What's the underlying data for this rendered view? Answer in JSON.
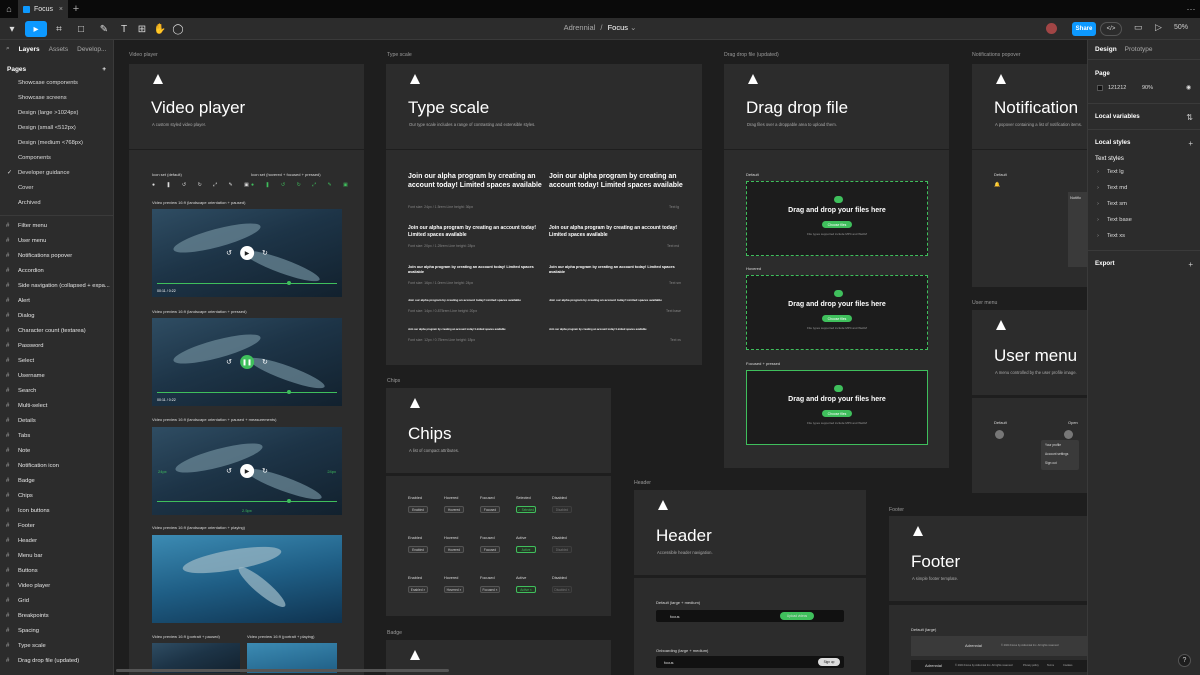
{
  "tabbar": {
    "home_icon": "⌂",
    "tab_label": "Focus",
    "close": "×",
    "add": "+",
    "more": "⋯"
  },
  "toolbar": {
    "tools": [
      "▾",
      "▸",
      "⌗",
      "□",
      "✎",
      "T",
      "⊞",
      "✋",
      "◯"
    ],
    "project": "Adrennial",
    "sep": "/",
    "file": "Focus",
    "file_arrow": "⌄",
    "share": "Share",
    "code": "</>",
    "book_icon": "▭",
    "play_icon": "▷",
    "zoom": "50%"
  },
  "left": {
    "tabs": [
      "Layers",
      "Assets",
      "Develop..."
    ],
    "pages_title": "Pages",
    "pages_add": "+",
    "pages": [
      "Showcase components",
      "Showcase screens",
      "Design (large >1024px)",
      "Design (small <512px)",
      "Design (medium <768px)",
      "Components",
      "Developer guidance",
      "Cover",
      "Archived"
    ],
    "check": "✓",
    "layers": [
      "Filter menu",
      "User menu",
      "Notifications popover",
      "Accordion",
      "Side navigation (collapsed + expa...",
      "Alert",
      "Dialog",
      "Character count (textarea)",
      "Password",
      "Select",
      "Username",
      "Search",
      "Multi-select",
      "Details",
      "Tabs",
      "Note",
      "Notification icon",
      "Badge",
      "Chips",
      "Icon buttons",
      "Footer",
      "Header",
      "Menu bar",
      "Buttons",
      "Video player",
      "Grid",
      "Breakpoints",
      "Spacing",
      "Type scale",
      "Drag drop file (updated)"
    ]
  },
  "frames": {
    "video": {
      "label": "Video player",
      "title": "Video player",
      "desc": "A custom styled video player.",
      "iconset_default": "Icon set (default)",
      "iconset_hover": "Icon set (hovered + focused + pressed)",
      "v1": "Video preview 16:9 (landscape orientation + paused)",
      "v2": "Video preview 16:9 (landscape orientation + pressed)",
      "v3": "Video preview 16:9 (landscape orientation + paused + measurements)",
      "v4": "Video preview 16:9 (landscape orientation + playing)",
      "v5": "Video preview 16:9 (portrait + paused)",
      "v6": "Video preview 16:9 (portrait + playing)",
      "time": "00:11 / 0:22",
      "play": "▶",
      "pause": "❚❚",
      "skip_back": "↺",
      "skip_fwd": "↻",
      "measure_l": "24px",
      "measure_r": "24px",
      "measure_b": "2.5px",
      "progress": 0.7
    },
    "type": {
      "label": "Type scale",
      "title": "Type scale",
      "desc": "Our type scale includes a range of contrasting and extensible styles.",
      "sample": "Join our alpha program by creating an account today! Limited spaces available",
      "m1": "Font size: 24px / 1.5rem    Line height: 36px",
      "m2": "Font size: 20px / 1.25rem    Line height: 28px",
      "m3": "Font size: 16px / 1.0rem    Line height: 24px",
      "m4": "Font size: 14px / 0.875rem    Line height: 20px",
      "m5": "Font size: 12px / 0.75rem    Line height: 18px",
      "n1": "Text lg",
      "n2": "Text md",
      "n3": "Text sm",
      "n4": "Text base",
      "n5": "Text xs"
    },
    "drag": {
      "label": "Drag drop file (updated)",
      "title": "Drag drop file",
      "desc": "Drag files over a droppable area to upload them.",
      "s1": "Default",
      "s2": "Hovered",
      "s3": "Focused + pressed",
      "text": "Drag and drop your files here",
      "button": "Choose files",
      "sub": "File types supported include MP4 and WebM"
    },
    "notif": {
      "label": "Notifications popover",
      "title": "Notification",
      "desc": "A popover containing a list of notification items.",
      "default": "Default",
      "pop_title": "Notific"
    },
    "user": {
      "label": "User menu",
      "title": "User menu",
      "desc": "A menu controlled by the user profile image.",
      "default": "Default",
      "open": "Open",
      "items": [
        "Your profile",
        "Account settings",
        "Sign out"
      ]
    },
    "chips": {
      "label": "Chips",
      "title": "Chips",
      "desc": "A list of compact attributes.",
      "h1": [
        "Enabled",
        "Hovered",
        "Focused",
        "Selected",
        "Disabled"
      ],
      "h2": [
        "Enabled",
        "Hovered",
        "Focused",
        "Active",
        "Disabled"
      ],
      "h3": [
        "Enabled",
        "Hovered",
        "Focused",
        "Active",
        "Disabled"
      ],
      "c1": [
        "Enabled",
        "Hovered",
        "Focused",
        "✓ Selected",
        "Disabled"
      ],
      "c2": [
        "Enabled",
        "Hovered",
        "Focused",
        "Active",
        "Disabled"
      ],
      "c3": [
        "Enabled ×",
        "Hovered ×",
        "Focused ×",
        "Active ×",
        "Disabled ×"
      ]
    },
    "badge": {
      "label": "Badge"
    },
    "header": {
      "label": "Header",
      "title": "Header",
      "desc": "Accessible header navigation.",
      "d1": "Default (large + medium)",
      "d2": "Onboarding (large + medium)",
      "brand": "focus",
      "upload": "Upload videos",
      "signup": "Sign up"
    },
    "footer": {
      "label": "Footer",
      "title": "Footer",
      "desc": "A simple footer template.",
      "d1": "Default (large)",
      "brand": "Adrennial",
      "copy": "© 2024 Focus by Adrennial Inc. All rights reserved",
      "links": [
        "Privacy policy",
        "Terms",
        "Cookies"
      ]
    }
  },
  "right": {
    "tabs": [
      "Design",
      "Prototype"
    ],
    "page": "Page",
    "color": "121212",
    "opacity": "90%",
    "eye": "◉",
    "local_vars": "Local variables",
    "local_styles": "Local styles",
    "text_styles": "Text styles",
    "styles": [
      "Text lg",
      "Text md",
      "Text sm",
      "Text base",
      "Text xs"
    ],
    "export": "Export",
    "plus": "+"
  },
  "help": "?"
}
